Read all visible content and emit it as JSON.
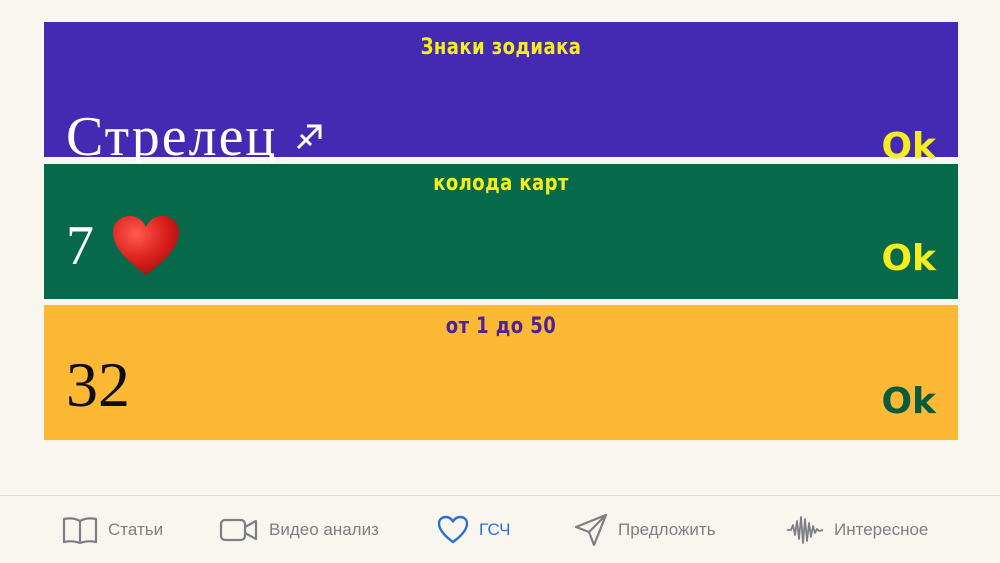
{
  "cards": [
    {
      "title": "Знаки зодиака",
      "value": "Стрелец",
      "symbol": "♐",
      "button": "Ok"
    },
    {
      "title": "колода карт",
      "value": "7",
      "suit_icon": "heart-icon",
      "button": "Ok"
    },
    {
      "title": "от 1 до 50",
      "value": "32",
      "button": "Ok"
    }
  ],
  "tabs": [
    {
      "label": "Статьи",
      "icon": "book-icon"
    },
    {
      "label": "Видео анализ",
      "icon": "video-camera-icon"
    },
    {
      "label": "ГСЧ",
      "icon": "heart-outline-icon",
      "active": true
    },
    {
      "label": "Предложить",
      "icon": "paper-plane-icon"
    },
    {
      "label": "Интересное",
      "icon": "waveform-icon"
    }
  ],
  "colors": {
    "background": "#f8f6ef",
    "card1": "#4429b2",
    "card2": "#05694a",
    "card3": "#fdb935",
    "accent_yellow": "#f5ee1f",
    "title3": "#4a2394",
    "ok3": "#0a5a3e",
    "tab_active": "#2b6fd6",
    "tab_inactive": "#7d7f85"
  }
}
